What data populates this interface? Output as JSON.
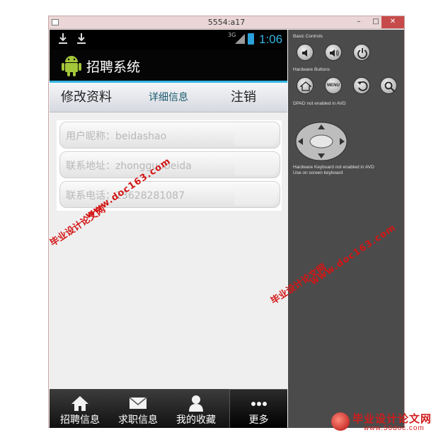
{
  "window": {
    "title": "5554:a17",
    "min_glyph": "–",
    "max_glyph": "□",
    "close_glyph": "✕"
  },
  "status_bar": {
    "network": "3G",
    "time": "1:06"
  },
  "app": {
    "title": "招聘系统"
  },
  "tabs": [
    {
      "label": "修改资料"
    },
    {
      "label": "详细信息"
    },
    {
      "label": "注销"
    }
  ],
  "fields": [
    {
      "text": "用户昵称：beidashao"
    },
    {
      "text": "联系地址：zhongguobeida"
    },
    {
      "text": "联系电话：13628281087"
    }
  ],
  "bottom_nav": [
    {
      "label": "招聘信息",
      "icon": "home-icon"
    },
    {
      "label": "求职信息",
      "icon": "mail-icon"
    },
    {
      "label": "我的收藏",
      "icon": "person-icon"
    },
    {
      "label": "更多",
      "icon": "more-dots-icon"
    }
  ],
  "controls": {
    "basic_label": "Basic Controls",
    "hardware_label": "Hardware Buttons",
    "menu_label": "MENU",
    "dpad_label": "DPAD not enabled in AVD",
    "keyboard_label": "Hardware Keyboard not enabled in AVD",
    "onscreen_label": "Use on screen keyboard"
  },
  "watermarks": {
    "site_name": "毕业设计论文网",
    "site_url": "www.doc163.com"
  },
  "brand": {
    "title": "毕业设计论文网",
    "url": "www.56doc.com"
  },
  "colors": {
    "accent_blue": "#33b5e5",
    "watermark_red": "#d41616"
  }
}
